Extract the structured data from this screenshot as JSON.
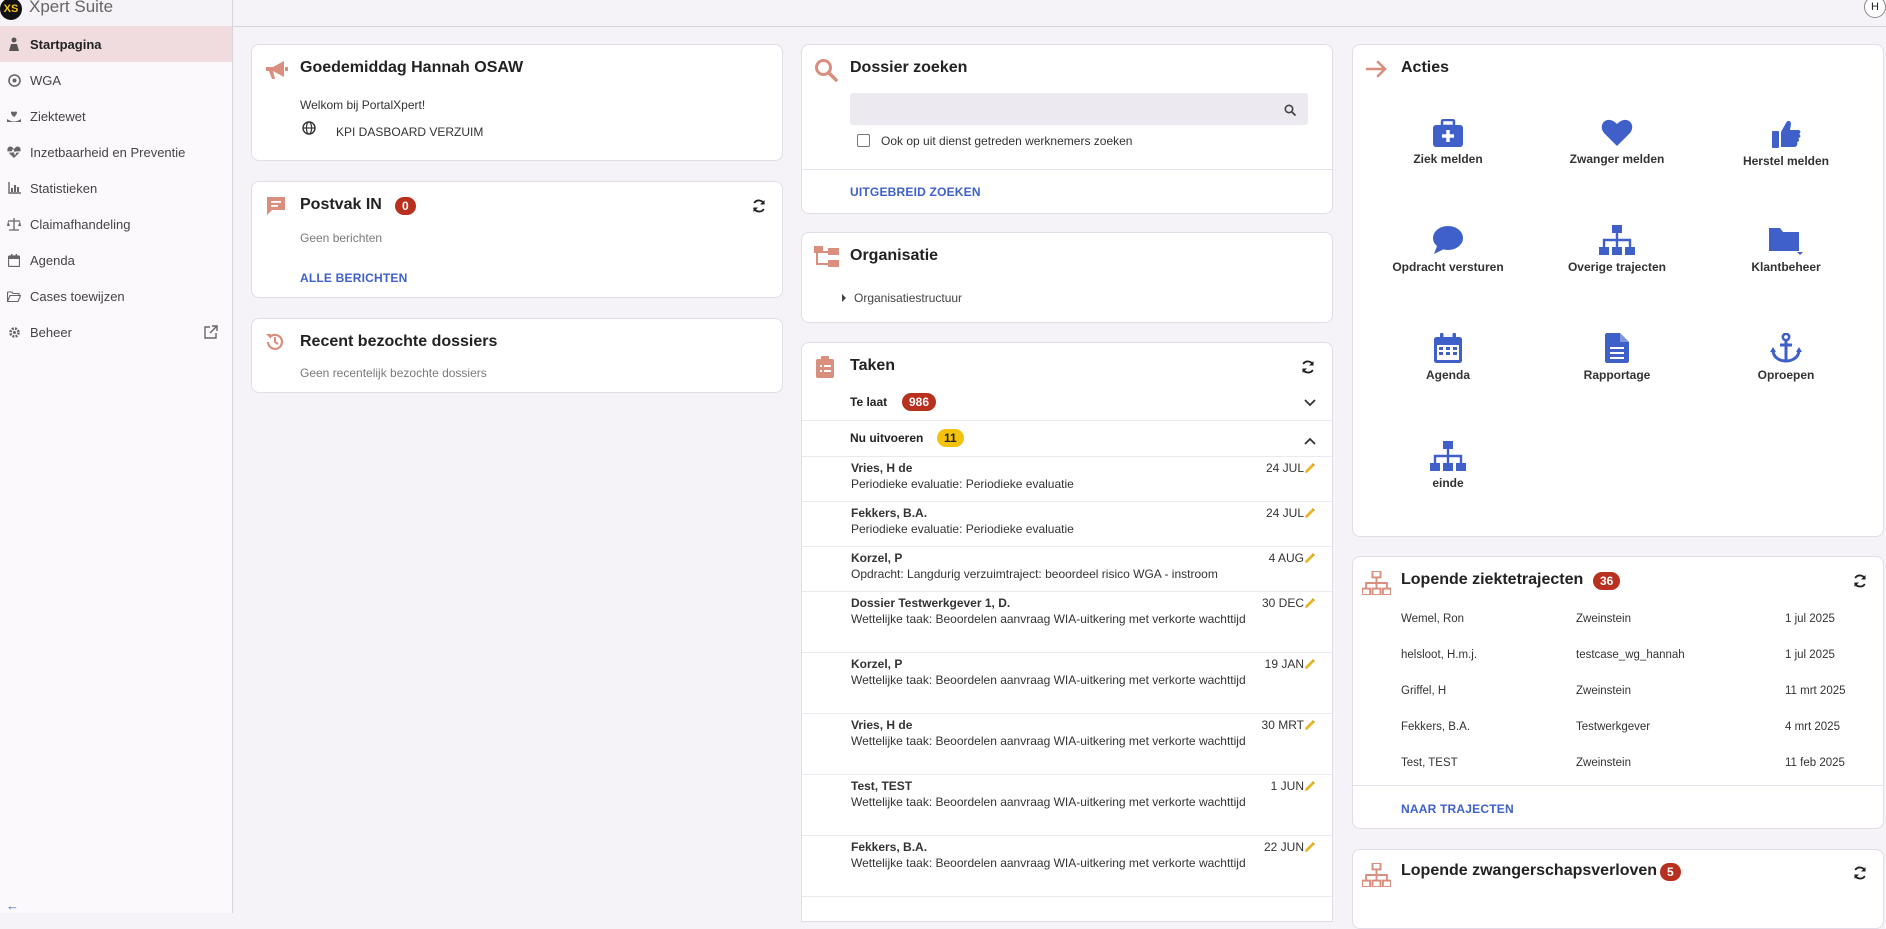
{
  "app": {
    "logo_text": "XS",
    "title": "Xpert Suite",
    "user_initial": "H"
  },
  "sidebar": {
    "items": [
      {
        "label": "Startpagina",
        "icon": "person-icon",
        "active": true
      },
      {
        "label": "WGA",
        "icon": "gear-circle-icon"
      },
      {
        "label": "Ziektewet",
        "icon": "hand-heart-icon"
      },
      {
        "label": "Inzetbaarheid en Preventie",
        "icon": "heart-pulse-icon"
      },
      {
        "label": "Statistieken",
        "icon": "chart-icon"
      },
      {
        "label": "Claimafhandeling",
        "icon": "scale-icon"
      },
      {
        "label": "Agenda",
        "icon": "calendar-icon"
      },
      {
        "label": "Cases toewijzen",
        "icon": "folder-open-icon"
      },
      {
        "label": "Beheer",
        "icon": "gear-icon",
        "external": true
      }
    ],
    "collapse_glyph": "←"
  },
  "welcome": {
    "title": "Goedemiddag Hannah OSAW",
    "text": "Welkom bij PortalXpert!",
    "link": "KPI DASBOARD VERZUIM"
  },
  "inbox": {
    "title": "Postvak IN",
    "count": "0",
    "empty": "Geen berichten",
    "link": "ALLE BERICHTEN"
  },
  "recent": {
    "title": "Recent bezochte dossiers",
    "empty": "Geen recentelijk bezochte dossiers"
  },
  "dossier_search": {
    "title": "Dossier zoeken",
    "search_value": "",
    "checkbox_label": "Ook op uit dienst getreden werknemers zoeken",
    "checkbox_checked": false,
    "link": "UITGEBREID ZOEKEN"
  },
  "organisation": {
    "title": "Organisatie",
    "tree_item": "Organisatiestructuur"
  },
  "tasks": {
    "title": "Taken",
    "late": {
      "label": "Te laat",
      "count": "986"
    },
    "now": {
      "label": "Nu uitvoeren",
      "count": "11"
    },
    "items": [
      {
        "name": "Vries, H de",
        "desc": "Periodieke evaluatie: Periodieke evaluatie",
        "date": "24 JUL"
      },
      {
        "name": "Fekkers, B.A.",
        "desc": "Periodieke evaluatie: Periodieke evaluatie",
        "date": "24 JUL"
      },
      {
        "name": "Korzel, P",
        "desc": "Opdracht: Langdurig verzuimtraject: beoordeel risico WGA - instroom",
        "date": "4 AUG"
      },
      {
        "name": "Dossier Testwerkgever 1, D.",
        "desc": "Wettelijke taak: Beoordelen aanvraag WIA-uitkering met verkorte wachttijd",
        "date": "30 DEC"
      },
      {
        "name": "Korzel, P",
        "desc": "Wettelijke taak: Beoordelen aanvraag WIA-uitkering met verkorte wachttijd",
        "date": "19 JAN"
      },
      {
        "name": "Vries, H de",
        "desc": "Wettelijke taak: Beoordelen aanvraag WIA-uitkering met verkorte wachttijd",
        "date": "30 MRT"
      },
      {
        "name": "Test, TEST",
        "desc": "Wettelijke taak: Beoordelen aanvraag WIA-uitkering met verkorte wachttijd",
        "date": "1 JUN"
      },
      {
        "name": "Fekkers, B.A.",
        "desc": "Wettelijke taak: Beoordelen aanvraag WIA-uitkering met verkorte wachttijd",
        "date": "22 JUN"
      }
    ]
  },
  "actions": {
    "title": "Acties",
    "items": [
      {
        "label": "Ziek melden",
        "icon": "medkit-icon"
      },
      {
        "label": "Zwanger melden",
        "icon": "heart-icon"
      },
      {
        "label": "Herstel melden",
        "icon": "thumbs-up-icon"
      },
      {
        "label": "Opdracht versturen",
        "icon": "chat-bubble-icon"
      },
      {
        "label": "Overige trajecten",
        "icon": "sitemap-icon"
      },
      {
        "label": "Klantbeheer",
        "icon": "folder-icon"
      },
      {
        "label": "Agenda",
        "icon": "calendar-icon"
      },
      {
        "label": "Rapportage",
        "icon": "document-icon"
      },
      {
        "label": "Oproepen",
        "icon": "anchor-icon"
      },
      {
        "label": "einde",
        "icon": "sitemap-icon"
      }
    ]
  },
  "ziekte": {
    "title": "Lopende ziektetrajecten",
    "count": "36",
    "rows": [
      {
        "name": "Wemel, Ron",
        "employer": "Zweinstein",
        "date": "1 jul 2025"
      },
      {
        "name": "helsloot, H.m.j.",
        "employer": "testcase_wg_hannah",
        "date": "1 jul 2025"
      },
      {
        "name": "Griffel, H",
        "employer": "Zweinstein",
        "date": "11 mrt 2025"
      },
      {
        "name": "Fekkers, B.A.",
        "employer": "Testwerkgever",
        "date": "4 mrt 2025"
      },
      {
        "name": "Test, TEST",
        "employer": "Zweinstein",
        "date": "11 feb 2025"
      }
    ],
    "link": "NAAR TRAJECTEN"
  },
  "zwanger": {
    "title": "Lopende zwangerschapsverloven",
    "count": "5"
  },
  "colors": {
    "accent": "#d98e7e",
    "primary": "#3f5fc9",
    "danger": "#b9301f",
    "warning": "#f4c20d"
  }
}
